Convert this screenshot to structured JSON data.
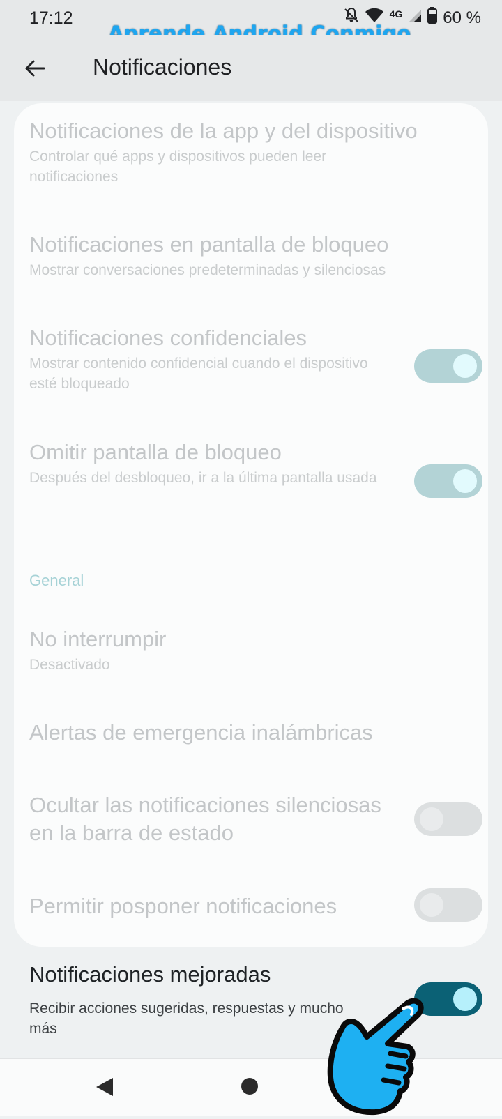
{
  "status_bar": {
    "time": "17:12",
    "network": "4G",
    "battery": "60 %",
    "icons": [
      "bell-off-icon",
      "wifi-icon",
      "signal-icon",
      "battery-icon"
    ]
  },
  "watermark": "Aprende Android Conmigo",
  "app_bar": {
    "title": "Notificaciones",
    "back_icon": "arrow-left-icon"
  },
  "items": [
    {
      "title": "Notificaciones de la app y del dispositivo",
      "subtitle": "Controlar qué apps y dispositivos pueden leer notificaciones"
    },
    {
      "title": "Notificaciones en pantalla de bloqueo",
      "subtitle": "Mostrar conversaciones predeterminadas y silenciosas"
    },
    {
      "title": "Notificaciones confidenciales",
      "subtitle": "Mostrar contenido confidencial cuando el dispositivo esté bloqueado",
      "toggle": "on"
    },
    {
      "title": "Omitir pantalla de bloqueo",
      "subtitle": "Después del desbloqueo, ir a la última pantalla usada",
      "toggle": "on"
    }
  ],
  "section_general": "General",
  "general_items": [
    {
      "title": "No interrumpir",
      "subtitle": "Desactivado"
    },
    {
      "title": "Alertas de emergencia inalámbricas"
    },
    {
      "title": "Ocultar las notificaciones silenciosas en la barra de estado",
      "toggle": "off"
    },
    {
      "title": "Permitir posponer notificaciones",
      "toggle": "off"
    }
  ],
  "enhanced": {
    "title": "Notificaciones mejoradas",
    "subtitle": "Recibir acciones sugeridas, respuestas y mucho más",
    "toggle": "on"
  },
  "colors": {
    "accent": "#0b6175",
    "watermark": "#1ea6f0",
    "disabled_text": "#c3c6c8"
  },
  "overlay_icon": "pointing-hand-icon"
}
